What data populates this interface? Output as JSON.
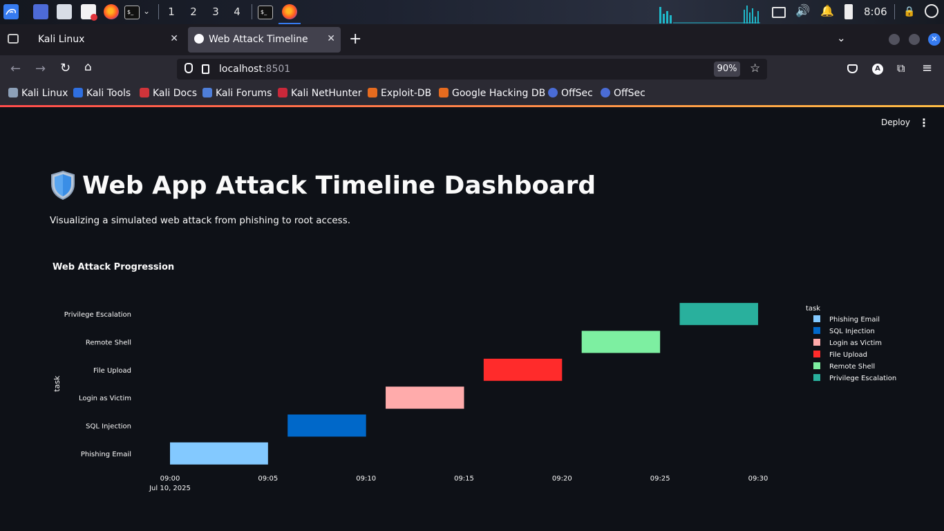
{
  "taskbar": {
    "workspaces": [
      "1",
      "2",
      "3",
      "4"
    ],
    "clock": "8:06"
  },
  "browser": {
    "tabs": [
      {
        "label": "Kali Linux",
        "active": false
      },
      {
        "label": "Web Attack Timeline",
        "active": true
      }
    ],
    "url_host": "localhost",
    "url_port": ":8501",
    "zoom": "90%",
    "bookmarks": [
      "Kali Linux",
      "Kali Tools",
      "Kali Docs",
      "Kali Forums",
      "Kali NetHunter",
      "Exploit-DB",
      "Google Hacking DB",
      "OffSec",
      "OffSec"
    ]
  },
  "app": {
    "deploy_label": "Deploy",
    "menu_icon": "more-vertical-icon",
    "title": "Web App Attack Timeline Dashboard",
    "title_icon": "shield-icon",
    "subtitle": "Visualizing a simulated web attack from phishing to root access."
  },
  "chart_data": {
    "type": "timeline",
    "title": "Web Attack Progression",
    "ylabel": "task",
    "xlabel": "",
    "date_label": "Jul 10, 2025",
    "x_ticks": [
      "09:00",
      "09:05",
      "09:10",
      "09:15",
      "09:20",
      "09:25",
      "09:30"
    ],
    "xlim": [
      "09:00",
      "09:30"
    ],
    "legend_title": "task",
    "legend_position": "right",
    "tasks": [
      {
        "name": "Phishing Email",
        "start": "09:00",
        "end": "09:05",
        "color": "#83c9ff"
      },
      {
        "name": "SQL Injection",
        "start": "09:06",
        "end": "09:10",
        "color": "#0068c9"
      },
      {
        "name": "Login as Victim",
        "start": "09:11",
        "end": "09:15",
        "color": "#ffabab"
      },
      {
        "name": "File Upload",
        "start": "09:16",
        "end": "09:20",
        "color": "#ff2b2b"
      },
      {
        "name": "Remote Shell",
        "start": "09:21",
        "end": "09:25",
        "color": "#7defa1"
      },
      {
        "name": "Privilege Escalation",
        "start": "09:26",
        "end": "09:30",
        "color": "#29b09d"
      }
    ]
  }
}
